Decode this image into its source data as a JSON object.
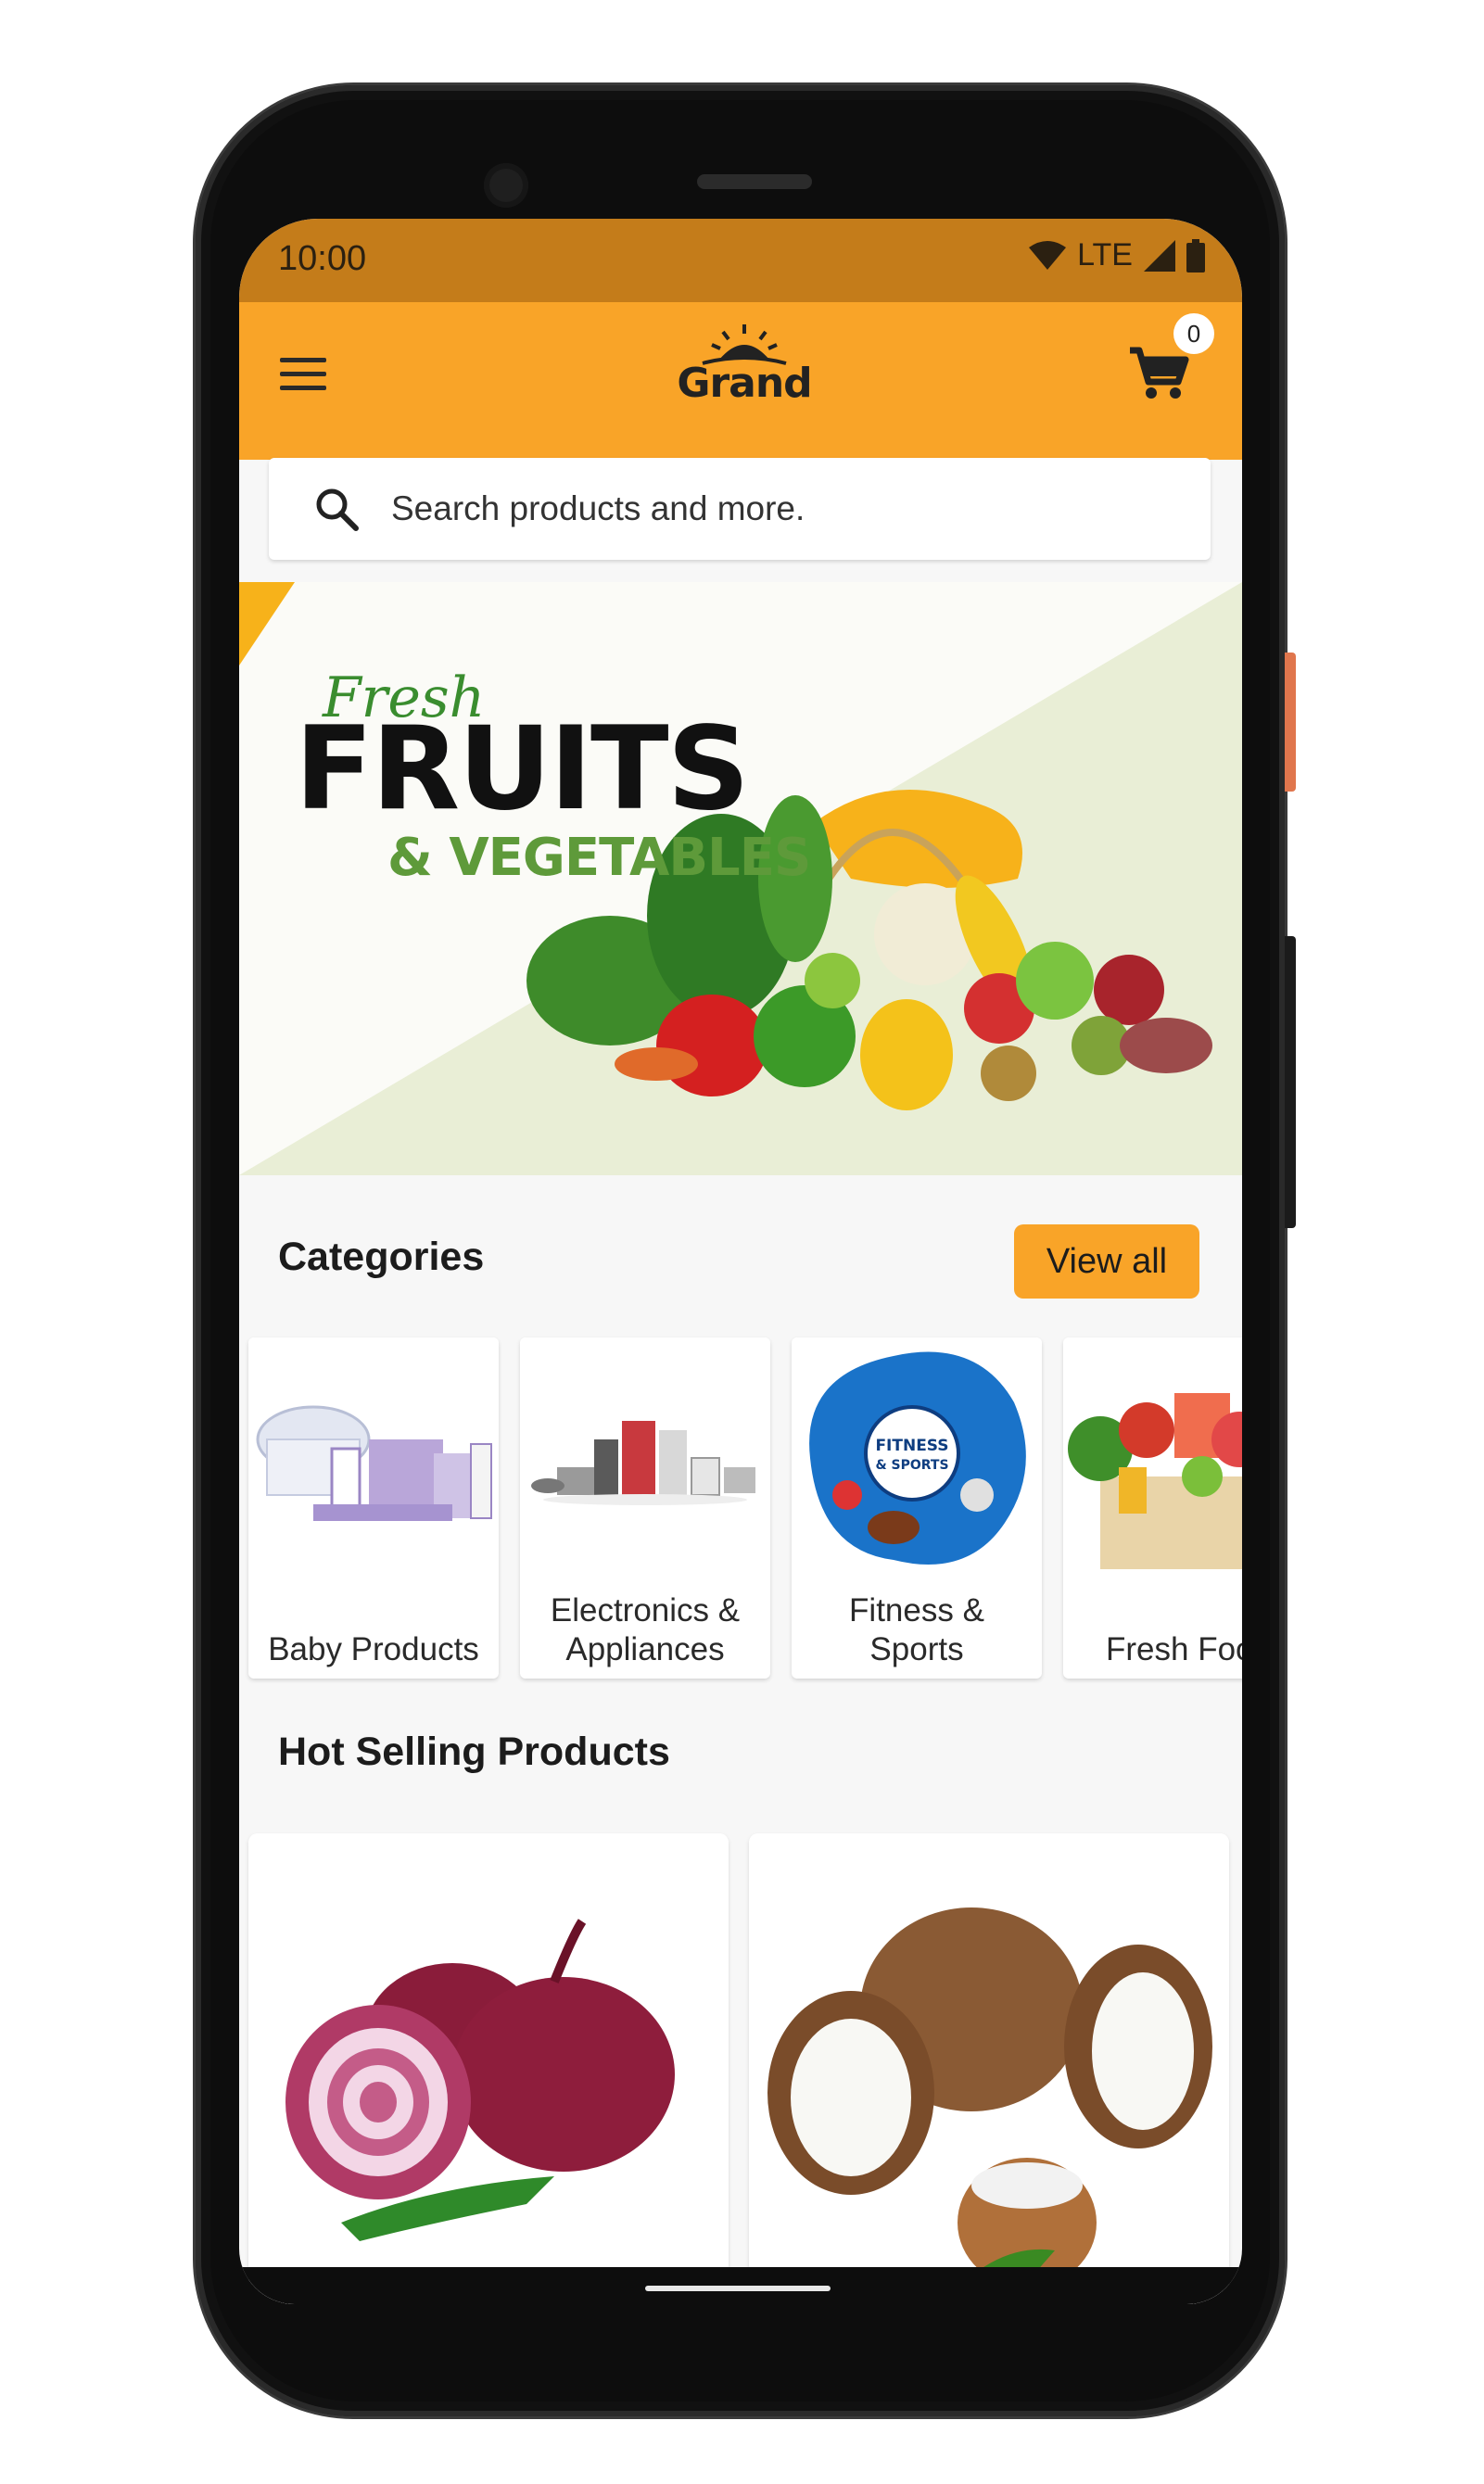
{
  "status_bar": {
    "time": "10:00",
    "network": "LTE"
  },
  "app_bar": {
    "logo_text": "Grand",
    "cart_count": "0",
    "accent_color": "#f9a428"
  },
  "search": {
    "placeholder": "Search products and more."
  },
  "banner": {
    "line1": "Fresh",
    "line2": "FRUITS",
    "line3": "& VEGETABLES"
  },
  "categories": {
    "title": "Categories",
    "view_all_label": "View all",
    "items": [
      {
        "label_line1": "Baby Products",
        "label_line2": "",
        "icon": "baby-products-image"
      },
      {
        "label_line1": "Electronics &",
        "label_line2": "Appliances",
        "icon": "electronics-appliances-image"
      },
      {
        "label_line1": "Fitness &",
        "label_line2": "Sports",
        "icon": "fitness-sports-image",
        "image_text": "FITNESS & SPORTS"
      },
      {
        "label_line1": "Fresh Foo",
        "label_line2": "",
        "icon": "fresh-food-image"
      }
    ]
  },
  "hot_selling": {
    "title": "Hot Selling Products",
    "items": [
      {
        "icon": "onion-image"
      },
      {
        "icon": "coconut-image"
      }
    ]
  }
}
